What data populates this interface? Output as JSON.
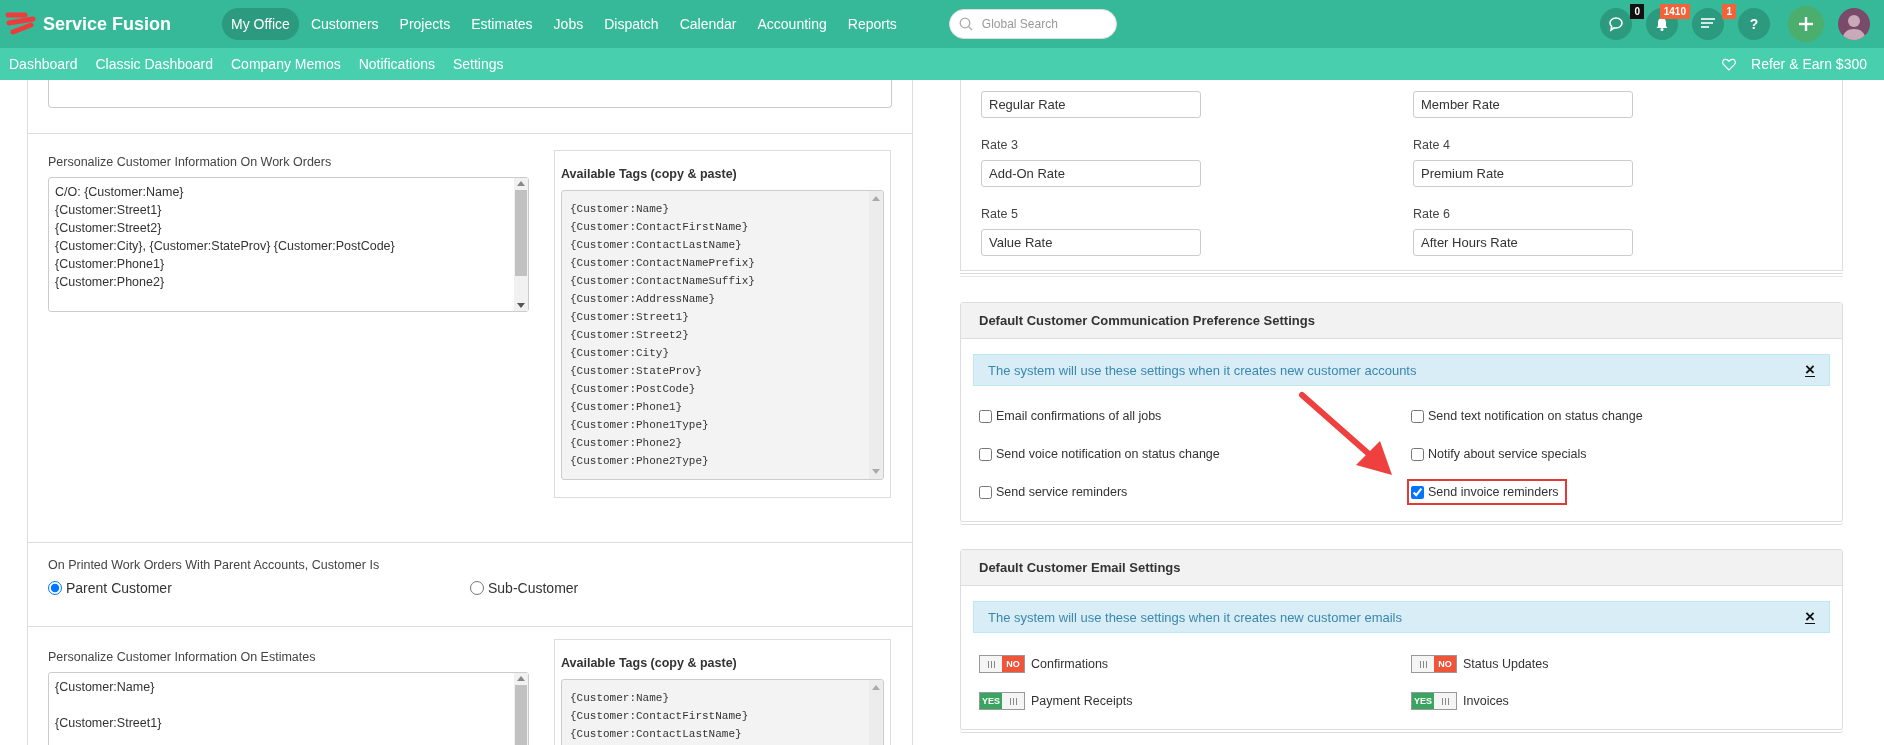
{
  "app": {
    "name": "Service Fusion"
  },
  "main_nav": [
    {
      "label": "My Office",
      "selected": true
    },
    {
      "label": "Customers",
      "selected": false
    },
    {
      "label": "Projects",
      "selected": false
    },
    {
      "label": "Estimates",
      "selected": false
    },
    {
      "label": "Jobs",
      "selected": false
    },
    {
      "label": "Dispatch",
      "selected": false
    },
    {
      "label": "Calendar",
      "selected": false
    },
    {
      "label": "Accounting",
      "selected": false
    },
    {
      "label": "Reports",
      "selected": false
    }
  ],
  "search": {
    "placeholder": "Global Search"
  },
  "header_icons": [
    {
      "kind": "chat",
      "badge": "0",
      "color": "#111111"
    },
    {
      "kind": "bell",
      "badge": "1410",
      "color": "#f4623a"
    },
    {
      "kind": "list",
      "badge": "1",
      "color": "#f4623a"
    },
    {
      "kind": "help",
      "label": "?"
    },
    {
      "kind": "add"
    },
    {
      "kind": "avatar"
    }
  ],
  "sub_nav": [
    {
      "label": "Dashboard"
    },
    {
      "label": "Classic Dashboard"
    },
    {
      "label": "Company Memos"
    },
    {
      "label": "Notifications"
    },
    {
      "label": "Settings"
    }
  ],
  "refer_link": "Refer & Earn $300",
  "work_orders": {
    "label": "Personalize Customer Information On Work Orders",
    "value": "C/O: {Customer:Name}\n{Customer:Street1}\n{Customer:Street2}\n{Customer:City}, {Customer:StateProv} {Customer:PostCode}\n{Customer:Phone1}\n{Customer:Phone2}",
    "tags_title": "Available Tags (copy & paste)",
    "tags": [
      "{Customer:Name}",
      "{Customer:ContactFirstName}",
      "{Customer:ContactLastName}",
      "{Customer:ContactNamePrefix}",
      "{Customer:ContactNameSuffix}",
      "{Customer:AddressName}",
      "{Customer:Street1}",
      "{Customer:Street2}",
      "{Customer:City}",
      "{Customer:StateProv}",
      "{Customer:PostCode}",
      "{Customer:Phone1}",
      "{Customer:Phone1Type}",
      "{Customer:Phone2}",
      "{Customer:Phone2Type}"
    ]
  },
  "parent_setting": {
    "label": "On Printed Work Orders With Parent Accounts, Customer Is",
    "options": [
      {
        "label": "Parent Customer",
        "selected": true
      },
      {
        "label": "Sub-Customer",
        "selected": false
      }
    ]
  },
  "estimates": {
    "label": "Personalize Customer Information On Estimates",
    "value": "{Customer:Name}\n\n{Customer:Street1}",
    "tags_title": "Available Tags (copy & paste)",
    "tags": [
      "{Customer:Name}",
      "{Customer:ContactFirstName}",
      "{Customer:ContactLastName}"
    ]
  },
  "rates": [
    {
      "value": "Regular Rate"
    },
    {
      "value": "Member Rate"
    },
    {
      "label": "Rate 3",
      "value": "Add-On Rate"
    },
    {
      "label": "Rate 4",
      "value": "Premium Rate"
    },
    {
      "label": "Rate 5",
      "value": "Value Rate"
    },
    {
      "label": "Rate 6",
      "value": "After Hours Rate"
    }
  ],
  "communication": {
    "title": "Default Customer Communication Preference Settings",
    "notice": "The system will use these settings when it creates new customer accounts",
    "close": "×",
    "options": [
      {
        "label": "Email confirmations of all jobs",
        "checked": false,
        "highlighted": false
      },
      {
        "label": "Send text notification on status change",
        "checked": false,
        "highlighted": false
      },
      {
        "label": "Send voice notification on status change",
        "checked": false,
        "highlighted": false
      },
      {
        "label": "Notify about service specials",
        "checked": false,
        "highlighted": false
      },
      {
        "label": "Send service reminders",
        "checked": false,
        "highlighted": false
      },
      {
        "label": "Send invoice reminders",
        "checked": true,
        "highlighted": true
      }
    ]
  },
  "email": {
    "title": "Default Customer Email Settings",
    "notice": "The system will use these settings when it creates new customer emails",
    "close": "×",
    "toggles": [
      {
        "label": "Confirmations",
        "on": false,
        "state": "NO"
      },
      {
        "label": "Status Updates",
        "on": false,
        "state": "NO"
      },
      {
        "label": "Payment Receipts",
        "on": true,
        "state": "YES"
      },
      {
        "label": "Invoices",
        "on": true,
        "state": "YES"
      }
    ]
  }
}
